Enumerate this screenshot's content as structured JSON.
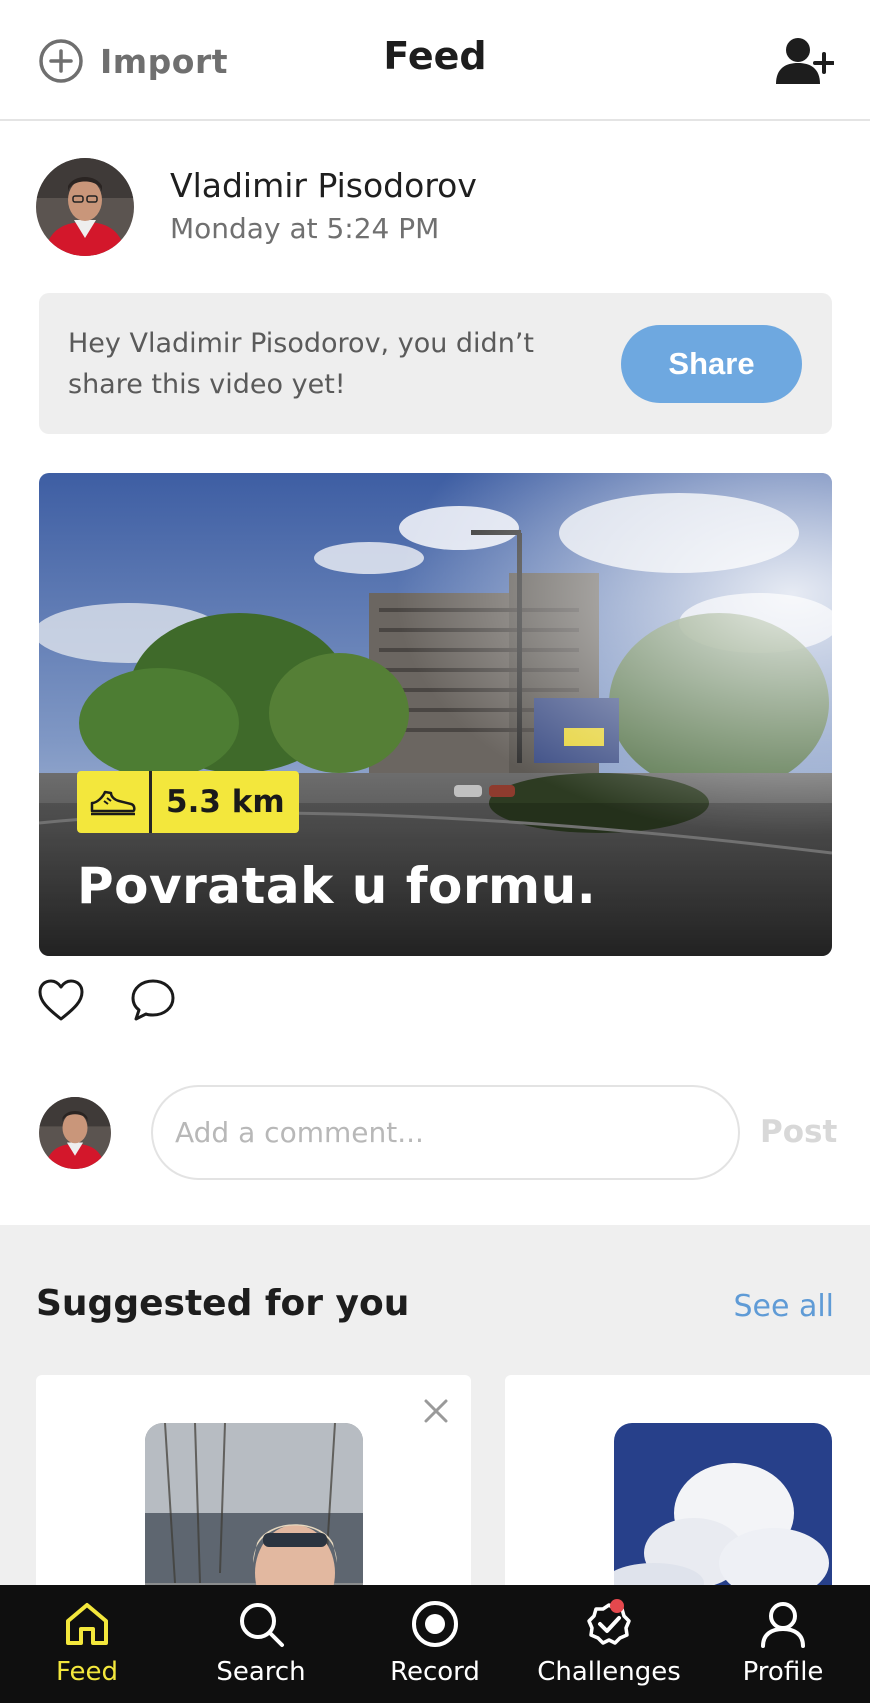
{
  "header": {
    "import_label": "Import",
    "title": "Feed",
    "import_icon": "plus-circle-icon",
    "add_friend_icon": "add-user-icon"
  },
  "post": {
    "author": "Vladimir Pisodorov",
    "time": "Monday at 5:24 PM",
    "share_prompt": "Hey Vladimir Pisodorov, you didn’t share this video yet!",
    "share_button": "Share",
    "distance": "5.3 km",
    "activity_icon": "running-shoe-icon",
    "activity_title": "Povratak u formu.",
    "like_icon": "heart-icon",
    "comment_icon": "comment-bubble-icon"
  },
  "comment": {
    "placeholder": "Add a comment...",
    "post_label": "Post"
  },
  "suggested": {
    "title": "Suggested for you",
    "see_all": "See all"
  },
  "nav": {
    "items": [
      {
        "label": "Feed",
        "icon": "home-icon",
        "active": true
      },
      {
        "label": "Search",
        "icon": "search-icon",
        "active": false
      },
      {
        "label": "Record",
        "icon": "record-icon",
        "active": false
      },
      {
        "label": "Challenges",
        "icon": "challenges-badge-icon",
        "active": false
      },
      {
        "label": "Profile",
        "icon": "user-icon",
        "active": false
      }
    ]
  },
  "colors": {
    "accent_yellow": "#f3e73c",
    "share_blue": "#6ea8e0",
    "link_blue": "#5f9bd6",
    "notification_red": "#e5484d",
    "nav_background": "#0f0f0f"
  }
}
